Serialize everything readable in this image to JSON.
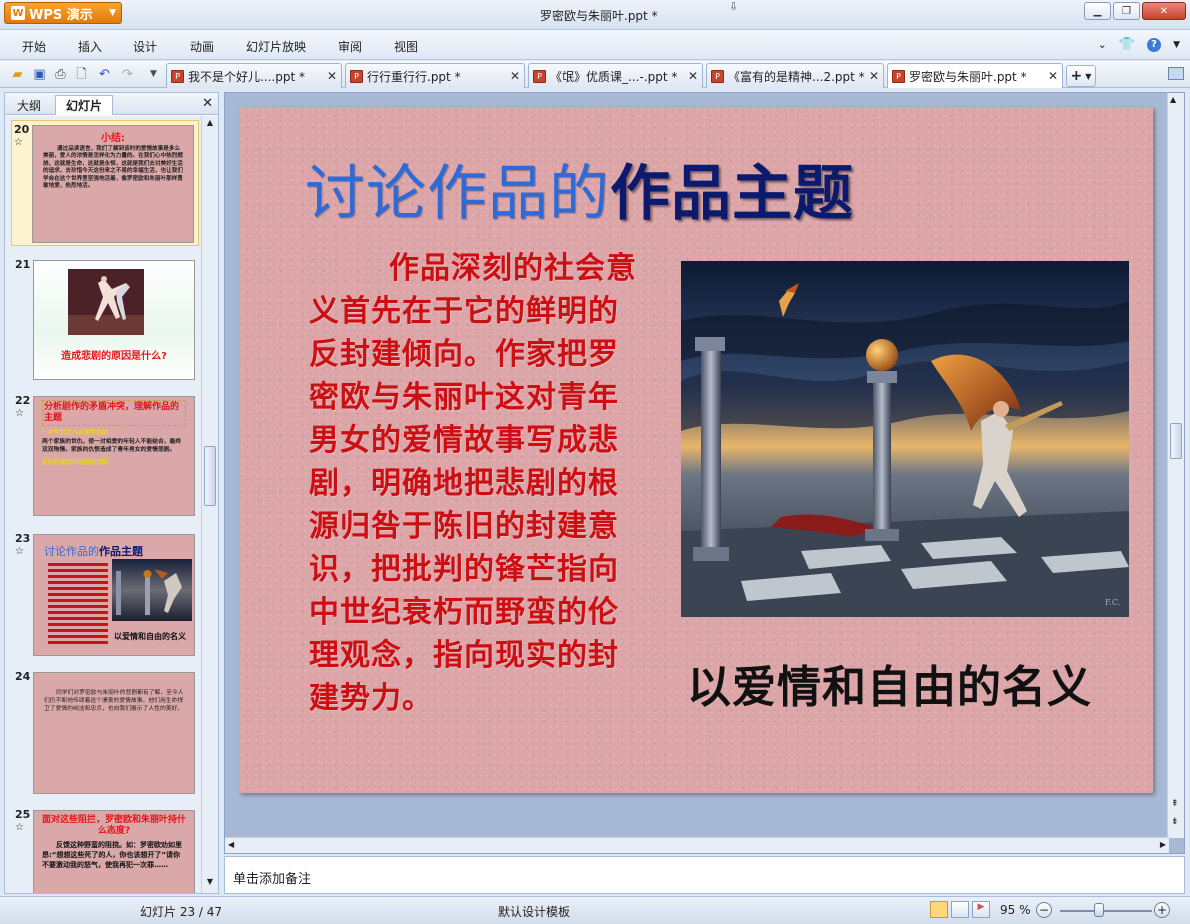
{
  "app": {
    "button_label": "WPS 演示",
    "window_title": "罗密欧与朱丽叶.ppt *"
  },
  "menu": [
    "开始",
    "插入",
    "设计",
    "动画",
    "幻灯片放映",
    "审阅",
    "视图"
  ],
  "tabs": [
    {
      "label": "我不是个好儿....ppt *"
    },
    {
      "label": "行行重行行.ppt *"
    },
    {
      "label": "《氓》优质课_...-.ppt *"
    },
    {
      "label": "《富有的是精神...2.ppt *"
    },
    {
      "label": "罗密欧与朱丽叶.ppt *"
    }
  ],
  "panel": {
    "tab_outline": "大纲",
    "tab_slides": "幻灯片"
  },
  "thumbnails": {
    "t20": {
      "num": "20",
      "title": "小结:",
      "text": "通过品读语言，我们了解到该时的爱情故事是多么美丽，爱人的浓情是怎样化为力量的。在我们心中热烈燃烧，这就是生命，这就是永恒，这就是我们去对美好生活的追求，去珍惜今天这份来之不易的幸福生活，也让我们学会在这个世界里坚强地活着，像罗密欧和朱丽叶那样勇敢地爱，热烈地活。"
    },
    "t21": {
      "num": "21",
      "caption": "造成悲剧的原因是什么?"
    },
    "t22": {
      "num": "22",
      "title": "分析剧作的矛盾冲突，理解作品的主题",
      "line1": "一对年轻恋人的爱情悲剧",
      "body": "两个家族的世仇，使一对相爱的年轻人不能结合，最终双双殉情。家族的仇恨造成了青年男女的爱情悲剧。",
      "foot": "反映封建家长制度的残酷"
    },
    "t23": {
      "num": "23",
      "title_a": "讨论作品的",
      "title_b": "作品主题",
      "caption": "以爱情和自由的名义"
    },
    "t24": {
      "num": "24",
      "text": "同学们对罗密欧与朱丽叶的悲剧都有了解，至今人们仍不断地传颂着这个凄美的爱情故事。他们用生命捍卫了爱情的纯洁和忠贞，也向我们展示了人性的美好。"
    },
    "t25": {
      "num": "25",
      "title": "面对这些阻拦，罗密欧和朱丽叶持什么态度?",
      "text": "反馈这种野蛮的阻挠。如：罗密欧劝如里昂:“想想这些死了的人，你也该想开了”请你不要激动我的怒气，使我再犯一次罪……"
    }
  },
  "slide": {
    "title_a": "讨论作品的",
    "title_b": "作品主题",
    "body": "作品深刻的社会意义首先在于它的鲜明的反封建倾向。作家把罗密欧与朱丽叶这对青年男女的爱情故事写成悲剧，明确地把悲剧的根源归咎于陈旧的封建意识，把批判的锋芒指向中世纪衰朽而野蛮的伦理观念，指向现实的封建势力。",
    "caption": "以爱情和自由的名义"
  },
  "notes_placeholder": "单击添加备注",
  "status": {
    "slide_counter": "幻灯片 23 / 47",
    "template": "默认设计模板",
    "zoom": "95 %"
  },
  "colors": {
    "slide_bg": "#dca5a8",
    "title_blue": "#2f6bd6",
    "title_dark": "#0b1a6e",
    "body_red": "#cc0f12",
    "wps_orange": "#f29a24"
  }
}
